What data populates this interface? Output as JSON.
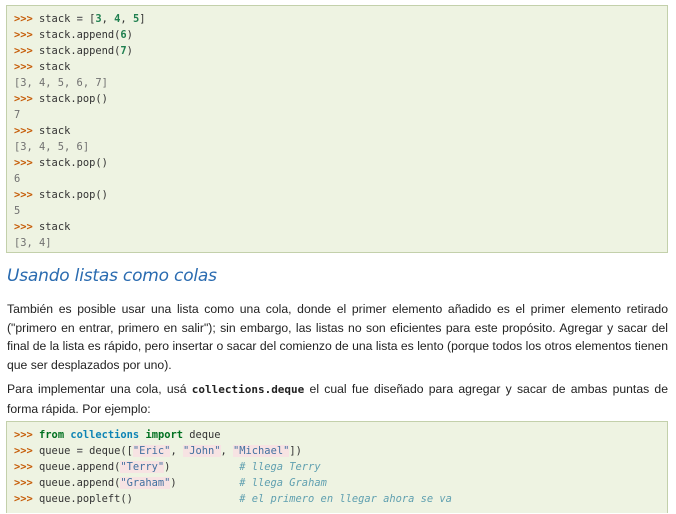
{
  "code_block_1": {
    "lines": [
      {
        "prompt": ">>>",
        "segments": [
          {
            "t": "stack ",
            "c": "plain"
          },
          {
            "t": "=",
            "c": "op"
          },
          {
            "t": " [",
            "c": "plain"
          },
          {
            "t": "3",
            "c": "num"
          },
          {
            "t": ", ",
            "c": "plain"
          },
          {
            "t": "4",
            "c": "num"
          },
          {
            "t": ", ",
            "c": "plain"
          },
          {
            "t": "5",
            "c": "num"
          },
          {
            "t": "]",
            "c": "plain"
          }
        ]
      },
      {
        "prompt": ">>>",
        "segments": [
          {
            "t": "stack.append(",
            "c": "plain"
          },
          {
            "t": "6",
            "c": "num"
          },
          {
            "t": ")",
            "c": "plain"
          }
        ]
      },
      {
        "prompt": ">>>",
        "segments": [
          {
            "t": "stack.append(",
            "c": "plain"
          },
          {
            "t": "7",
            "c": "num"
          },
          {
            "t": ")",
            "c": "plain"
          }
        ]
      },
      {
        "prompt": ">>>",
        "segments": [
          {
            "t": "stack",
            "c": "plain"
          }
        ]
      },
      {
        "output": "[3, 4, 5, 6, 7]"
      },
      {
        "prompt": ">>>",
        "segments": [
          {
            "t": "stack.pop()",
            "c": "plain"
          }
        ]
      },
      {
        "output": "7"
      },
      {
        "prompt": ">>>",
        "segments": [
          {
            "t": "stack",
            "c": "plain"
          }
        ]
      },
      {
        "output": "[3, 4, 5, 6]"
      },
      {
        "prompt": ">>>",
        "segments": [
          {
            "t": "stack.pop()",
            "c": "plain"
          }
        ]
      },
      {
        "output": "6"
      },
      {
        "prompt": ">>>",
        "segments": [
          {
            "t": "stack.pop()",
            "c": "plain"
          }
        ]
      },
      {
        "output": "5"
      },
      {
        "prompt": ">>>",
        "segments": [
          {
            "t": "stack",
            "c": "plain"
          }
        ]
      },
      {
        "output": "[3, 4]"
      }
    ]
  },
  "heading": "Usando listas como colas",
  "paragraph_1": "También es posible usar una lista como una cola, donde el primer elemento añadido es el primer elemento retirado (\"primero en entrar, primero en salir\"); sin embargo, las listas no son eficientes para este propósito. Agregar y sacar del final de la lista es rápido, pero insertar o sacar del comienzo de una lista es lento (porque todos los otros elementos tienen que ser desplazados por uno).",
  "paragraph_2": {
    "before": "Para implementar una cola, usá ",
    "code": "collections.deque",
    "after": " el cual fue diseñado para agregar y sacar de ambas puntas de forma rápida. Por ejemplo:"
  },
  "code_block_2": {
    "lines": [
      {
        "prompt": ">>>",
        "segments": [
          {
            "t": "from",
            "c": "kw"
          },
          {
            "t": " ",
            "c": "plain"
          },
          {
            "t": "collections",
            "c": "mod"
          },
          {
            "t": " ",
            "c": "plain"
          },
          {
            "t": "import",
            "c": "kw"
          },
          {
            "t": " deque",
            "c": "plain"
          }
        ]
      },
      {
        "prompt": ">>>",
        "segments": [
          {
            "t": "queue ",
            "c": "plain"
          },
          {
            "t": "=",
            "c": "op"
          },
          {
            "t": " deque([",
            "c": "plain"
          },
          {
            "t": "\"Eric\"",
            "c": "str"
          },
          {
            "t": ", ",
            "c": "plain"
          },
          {
            "t": "\"John\"",
            "c": "str"
          },
          {
            "t": ", ",
            "c": "plain"
          },
          {
            "t": "\"Michael\"",
            "c": "str"
          },
          {
            "t": "])",
            "c": "plain"
          }
        ]
      },
      {
        "prompt": ">>>",
        "segments": [
          {
            "t": "queue.append(",
            "c": "plain"
          },
          {
            "t": "\"Terry\"",
            "c": "str"
          },
          {
            "t": ")           ",
            "c": "plain"
          },
          {
            "t": "# llega Terry",
            "c": "cmt"
          }
        ]
      },
      {
        "prompt": ">>>",
        "segments": [
          {
            "t": "queue.append(",
            "c": "plain"
          },
          {
            "t": "\"Graham\"",
            "c": "str"
          },
          {
            "t": ")          ",
            "c": "plain"
          },
          {
            "t": "# llega Graham",
            "c": "cmt"
          }
        ]
      },
      {
        "prompt": ">>>",
        "segments": [
          {
            "t": "queue.popleft()                 ",
            "c": "plain"
          },
          {
            "t": "# el primero en llegar ahora se va",
            "c": "cmt"
          }
        ]
      }
    ]
  },
  "colors": {
    "code_background": "#eef3e2",
    "code_border": "#c3d0ab",
    "prompt": "#c65d09",
    "heading": "#2a6bb0",
    "string": "#4070a0",
    "comment": "#60a0b0",
    "keyword": "#007020"
  }
}
